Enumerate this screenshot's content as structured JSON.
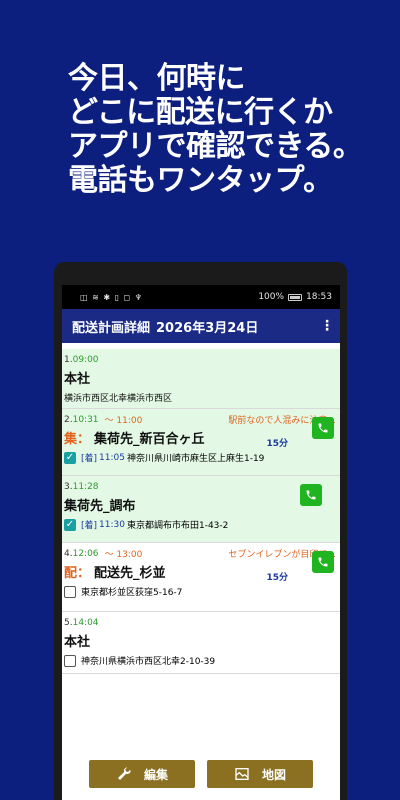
{
  "promo": {
    "lines": [
      "今日、何時に",
      "どこに配送に行くか",
      "アプリで確認できる。",
      "電話もワンタップ。"
    ]
  },
  "status_bar": {
    "left_icons": "◫ ≋ ✱ ▯ ◻ ♆",
    "battery_percent": "100%",
    "time": "18:53"
  },
  "app_bar": {
    "title": "配送計画詳細",
    "date": "2026年3月24日",
    "menu_icon": "more-vert-icon"
  },
  "stops": [
    {
      "num": "1.",
      "time": "09:00",
      "range": "",
      "note": "",
      "prefix": "",
      "name": "本社",
      "duration": "",
      "address": "横浜市西区北幸横浜市西区",
      "has_checkbox": false,
      "phone": false
    },
    {
      "num": "2.",
      "time": "10:31",
      "range": "〜 11:00",
      "note": "駅前なので人混みに注意...",
      "prefix": "集：",
      "name": "集荷先_新百合ヶ丘",
      "duration": "15分",
      "checked": true,
      "arrival_tag": "[着]",
      "arrival_time": "11:05",
      "address": "神奈川県川崎市麻生区上麻生1-19",
      "phone": true
    },
    {
      "num": "3.",
      "time": "11:28",
      "range": "",
      "note": "",
      "prefix": "",
      "name": "集荷先_調布",
      "duration": "",
      "checked": true,
      "arrival_tag": "[着]",
      "arrival_time": "11:30",
      "address": "東京都調布市布田1-43-2",
      "phone": true
    },
    {
      "num": "4.",
      "time": "12:06",
      "range": "〜 13:00",
      "note": "セブンイレブンが目印で...",
      "prefix": "配：",
      "name": "配送先_杉並",
      "duration": "15分",
      "checked": false,
      "address": "東京都杉並区荻窪5-16-7",
      "phone": true
    },
    {
      "num": "5.",
      "time": "14:04",
      "range": "",
      "note": "",
      "prefix": "",
      "name": "本社",
      "duration": "",
      "checked": false,
      "address": "神奈川県横浜市西区北幸2-10-39",
      "phone": false
    }
  ],
  "buttons": {
    "edit": "編集",
    "map": "地図"
  },
  "colors": {
    "background": "#0d1f7e",
    "app_bar": "#1a2a85",
    "card_green": "#e3f9e5",
    "time": "#2f9a2f",
    "accent_orange": "#e0641f",
    "phone_green": "#21b421",
    "button_gold": "#8a7020"
  }
}
